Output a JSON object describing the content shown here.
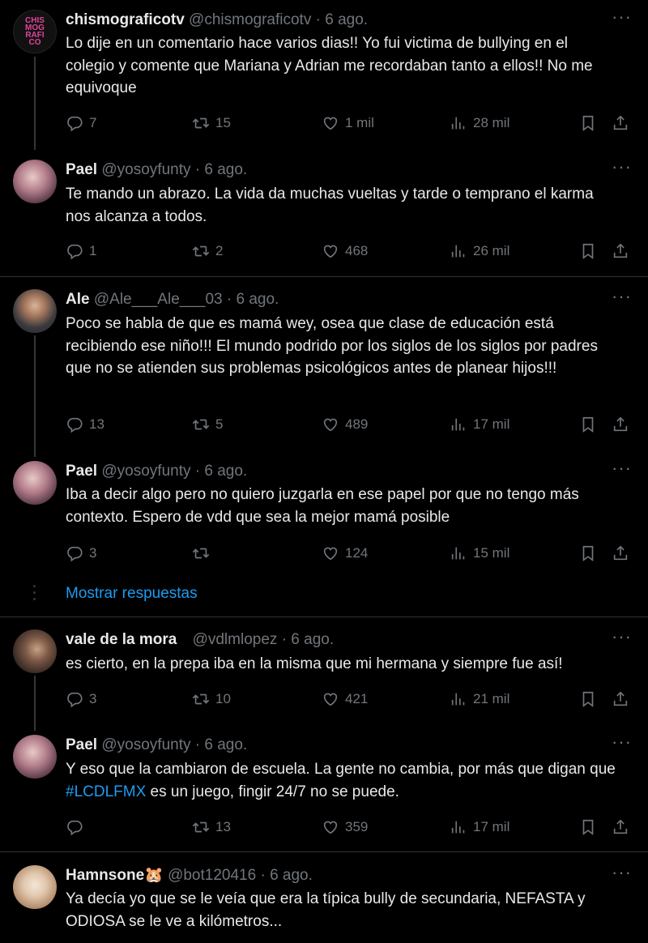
{
  "tweets": [
    {
      "name": "chismograficotv",
      "handle": "@chismograficotv",
      "date": "6 ago.",
      "text": "Lo dije en un comentario hace varios dias!! Yo fui victima de bullying en el colegio y comente que Mariana y Adrian me recordaban tanto a ellos!! No me equivoque",
      "replies": "7",
      "retweets": "15",
      "likes": "1 mil",
      "views": "28 mil",
      "avatar_text": "CHIS MOG RAFI CO"
    },
    {
      "name": "Pael",
      "handle": "@yosoyfunty",
      "date": "6 ago.",
      "text": "Te mando un abrazo. La vida da muchas vueltas y tarde o temprano el karma nos alcanza a todos.",
      "replies": "1",
      "retweets": "2",
      "likes": "468",
      "views": "26 mil"
    },
    {
      "name": "Ale",
      "handle": "@Ale___Ale___03",
      "date": "6 ago.",
      "text": "Poco se habla de que es mamá wey, osea que clase de educación está recibiendo ese niño!!! El mundo podrido por los siglos de los siglos por padres que no se atienden sus problemas psicológicos antes de planear hijos!!!",
      "replies": "13",
      "retweets": "5",
      "likes": "489",
      "views": "17 mil"
    },
    {
      "name": "Pael",
      "handle": "@yosoyfunty",
      "date": "6 ago.",
      "text": "Iba a decir algo pero no quiero juzgarla en ese papel por que no tengo más contexto. Espero de vdd que sea la mejor mamá posible",
      "replies": "3",
      "retweets": "",
      "likes": "124",
      "views": "15 mil"
    },
    {
      "name": "vale de la mora",
      "handle": "@vdlmlopez",
      "date": "6 ago.",
      "text": "es cierto, en la prepa iba en la misma que mi hermana y siempre fue así!",
      "replies": "3",
      "retweets": "10",
      "likes": "421",
      "views": "21 mil"
    },
    {
      "name": "Pael",
      "handle": "@yosoyfunty",
      "date": "6 ago.",
      "text_before": "Y eso que la cambiaron de escuela. La gente no cambia, por más que digan que ",
      "hashtag": "#LCDLFMX",
      "text_after": " es un juego, fingir 24/7 no se puede.",
      "replies": "",
      "retweets": "13",
      "likes": "359",
      "views": "17 mil"
    },
    {
      "name": "Hamnsone🐹",
      "handle": "@bot120416",
      "date": "6 ago.",
      "text": "Ya decía yo que se le veía que era la típica bully de secundaria, NEFASTA y ODIOSA se le ve a kilómetros..."
    }
  ],
  "show_replies": "Mostrar respuestas",
  "separator_dot": "·",
  "more_glyph": "···",
  "colors": {
    "accent": "#1d9bf0",
    "muted": "#71767b",
    "text": "#e7e9ea",
    "bg": "#000000"
  }
}
